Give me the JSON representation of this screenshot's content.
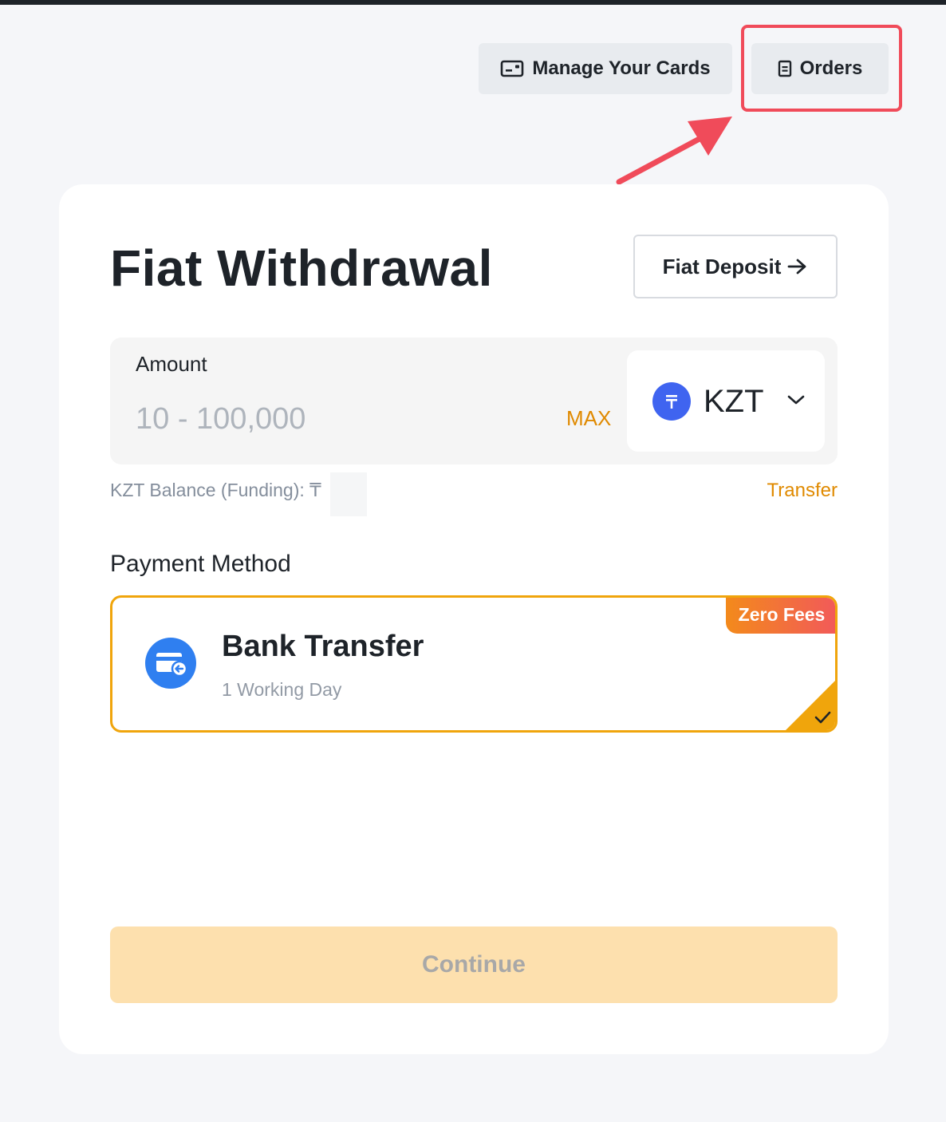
{
  "header": {
    "manage_cards_label": "Manage Your Cards",
    "orders_label": "Orders"
  },
  "page": {
    "title": "Fiat Withdrawal",
    "fiat_deposit_label": "Fiat Deposit"
  },
  "amount": {
    "label": "Amount",
    "placeholder": "10 - 100,000",
    "value": "",
    "max_label": "MAX",
    "currency_code": "KZT",
    "currency_symbol": "₸"
  },
  "balance": {
    "label": "KZT Balance (Funding): ₸",
    "transfer_label": "Transfer"
  },
  "payment_method": {
    "label": "Payment Method",
    "selected": {
      "name": "Bank Transfer",
      "duration": "1 Working Day",
      "badge": "Zero Fees"
    }
  },
  "actions": {
    "continue_label": "Continue"
  },
  "colors": {
    "accent": "#f0a50c",
    "highlight": "#f04b5a",
    "currency_icon": "#3f64f0",
    "bank_icon": "#2f7ff0"
  },
  "icons": {
    "manage_cards": "credit-card-icon",
    "orders": "document-icon",
    "deposit_arrow": "arrow-right-icon",
    "currency": "tenge-coin-icon",
    "dropdown": "chevron-down-icon",
    "bank": "bank-card-icon",
    "selected": "checkmark-icon"
  }
}
